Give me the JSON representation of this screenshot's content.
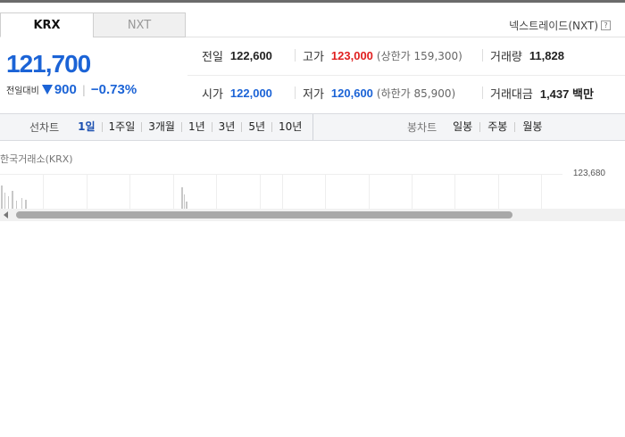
{
  "tabs": [
    {
      "label": "KRX",
      "active": true
    },
    {
      "label": "NXT",
      "active": false
    }
  ],
  "nxt_link": {
    "label": "넥스트레이드(NXT)",
    "help_icon": "?"
  },
  "quote": {
    "price": "121,700",
    "change_label": "전일대비",
    "direction_icon": "down-triangle",
    "change_amount": "900",
    "change_percent": "−0.73%"
  },
  "stats": {
    "prev_close": {
      "label": "전일",
      "value": "122,600"
    },
    "high": {
      "label": "고가",
      "value": "123,000",
      "limit": "(상한가 159,300)"
    },
    "volume": {
      "label": "거래량",
      "value": "11,828"
    },
    "open": {
      "label": "시가",
      "value": "122,000"
    },
    "low": {
      "label": "저가",
      "value": "120,600",
      "limit": "(하한가 85,900)"
    },
    "trade_value": {
      "label": "거래대금",
      "value": "1,437 백만"
    }
  },
  "line_chart": {
    "title": "선차트",
    "periods": [
      "1일",
      "1주일",
      "3개월",
      "1년",
      "3년",
      "5년",
      "10년"
    ],
    "selected": "1일"
  },
  "candle_chart": {
    "title": "봉차트",
    "periods": [
      "일봉",
      "주봉",
      "월봉"
    ]
  },
  "chart": {
    "source": "한국거래소(KRX)",
    "max_label": "123,680"
  },
  "colors": {
    "up": "#e02020",
    "down": "#1b63d6",
    "accent": "#1b4fb0"
  }
}
